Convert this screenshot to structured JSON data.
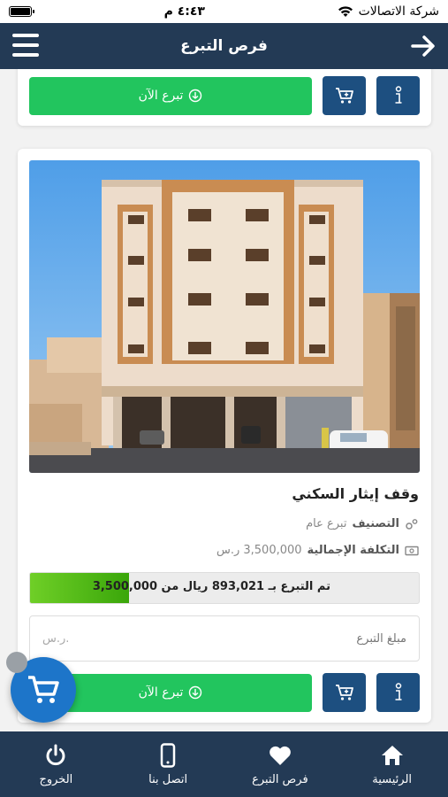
{
  "status_bar": {
    "carrier": "شركة الاتصالات",
    "time": "٤:٤٣ م"
  },
  "header": {
    "title": "فرص التبرع"
  },
  "top_card": {
    "donate_label": "تبرع الآن"
  },
  "project": {
    "title": "وقف إيثار السكني",
    "category_label": "التصنيف",
    "category_value": "تبرع عام",
    "total_cost_label": "التكلفة الإجمالية",
    "total_cost_value": "3,500,000 ر.س",
    "progress_text": "تم التبرع بـ 893,021 ريال من 3,500,000",
    "progress_fraction": 0.255,
    "amount_placeholder": "مبلغ التبرع",
    "amount_currency": "ر.س.",
    "donate_label": "تبرع الآن"
  },
  "bottom_nav": {
    "home": "الرئيسية",
    "opportunities": "فرص التبرع",
    "contact": "اتصل بنا",
    "logout": "الخروج"
  },
  "colors": {
    "header": "#233a55",
    "donate_green": "#22c55e",
    "action_blue": "#1d4f80",
    "fab_blue": "#1d75c9",
    "progress_green": "#4cb812"
  },
  "icons": {
    "menu": "hamburger-icon",
    "back": "arrow-right-icon",
    "cart": "cart-icon",
    "info": "info-icon",
    "category": "gears-icon",
    "cost": "money-icon",
    "home": "home-icon",
    "opportunities": "heart-icon",
    "contact": "phone-icon",
    "logout": "power-icon"
  }
}
